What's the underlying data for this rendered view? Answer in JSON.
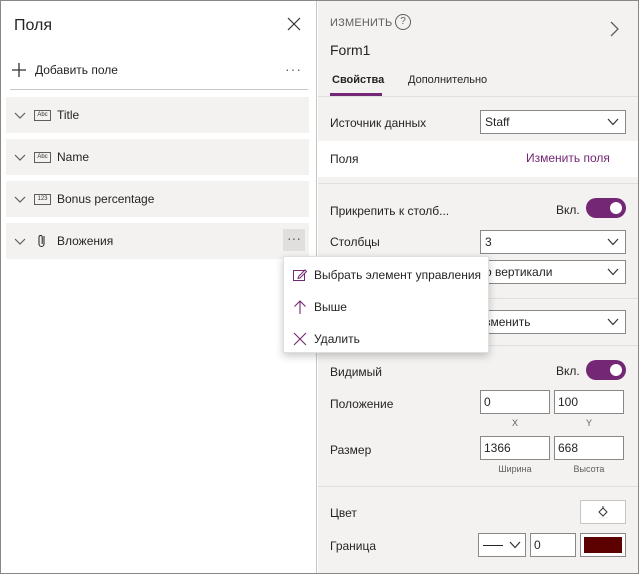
{
  "left_panel": {
    "title": "Поля",
    "add_field_label": "Добавить поле",
    "more_label": "···",
    "fields": [
      {
        "name": "Title",
        "type_icon": "Abc"
      },
      {
        "name": "Name",
        "type_icon": "Abc"
      },
      {
        "name": "Bonus percentage",
        "type_icon": "123"
      },
      {
        "name": "Вложения",
        "type_icon": "paperclip-icon"
      }
    ]
  },
  "context_menu": {
    "items": [
      {
        "label": "Выбрать элемент управления",
        "icon": "edit-control-icon"
      },
      {
        "label": "Выше",
        "icon": "arrow-up-icon"
      },
      {
        "label": "Удалить",
        "icon": "close-icon"
      }
    ]
  },
  "right_panel": {
    "header_label": "ИЗМЕНИТЬ",
    "help_glyph": "?",
    "control_name": "Form1",
    "tabs": {
      "properties": "Свойства",
      "advanced": "Дополнительно"
    },
    "data_source_label": "Источник данных",
    "data_source_value": "Staff",
    "fields_label": "Поля",
    "edit_fields_link": "Изменить поля",
    "snap_label": "Прикрепить к столб...",
    "snap_state": "Вкл.",
    "columns_label": "Столбцы",
    "columns_value": "3",
    "layout_value": "о вертикали",
    "mode_value": "зменить",
    "visible_label": "Видимый",
    "visible_state": "Вкл.",
    "position_label": "Положение",
    "position_x": "0",
    "position_y": "100",
    "x_caption": "X",
    "y_caption": "Y",
    "size_label": "Размер",
    "size_width": "1366",
    "size_height": "668",
    "width_caption": "Ширина",
    "height_caption": "Высота",
    "color_label": "Цвет",
    "border_label": "Граница",
    "border_width": "0",
    "border_color": "#5c0000",
    "accent_color": "#742774"
  }
}
